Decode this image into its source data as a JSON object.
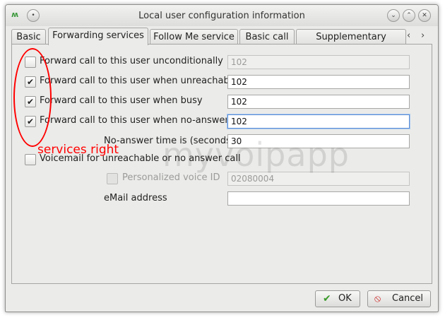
{
  "window": {
    "title": "Local user configuration information",
    "app_icon": "app-logo-icon"
  },
  "tabs": [
    {
      "label": "Basic"
    },
    {
      "label": "Forwarding services"
    },
    {
      "label": "Follow Me service"
    },
    {
      "label": "Basic call"
    },
    {
      "label": "Supplementary services"
    }
  ],
  "forwarding": {
    "unconditional": {
      "label": "Forward call to this user unconditionally",
      "checked": false,
      "value": "102"
    },
    "unreachable": {
      "label": "Forward call to this user when unreachable",
      "checked": true,
      "value": "102"
    },
    "busy": {
      "label": "Forward call to this user when busy",
      "checked": true,
      "value": "102"
    },
    "no_answer": {
      "label": "Forward call to this user when no-answer",
      "checked": true,
      "value": "102"
    },
    "no_answer_time": {
      "label": "No-answer time is (seconds)",
      "value": "30"
    },
    "voicemail": {
      "label": "Voicemail for unreachable or no answer call",
      "checked": false
    },
    "personalized_voice": {
      "label": "Personalized voice ID",
      "value": "02080004"
    },
    "email": {
      "label": "eMail address",
      "value": ""
    }
  },
  "annotation": {
    "text": "services right",
    "color": "#ff0000"
  },
  "watermark": {
    "text": "myvoipapp"
  },
  "buttons": {
    "ok": "OK",
    "cancel": "Cancel"
  }
}
